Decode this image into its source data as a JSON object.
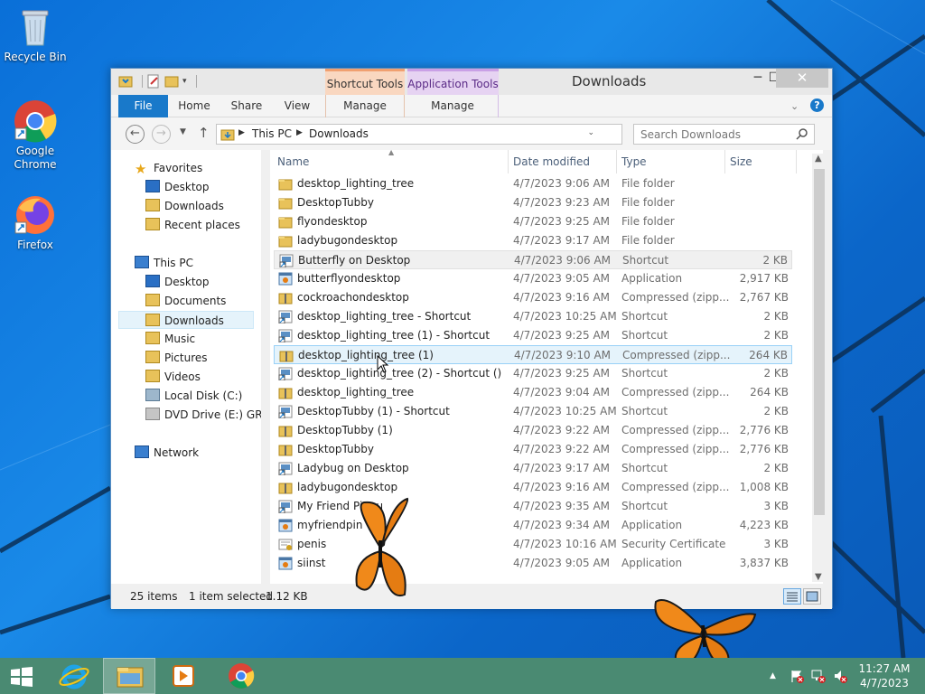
{
  "desktop": {
    "icons": [
      {
        "label": "Recycle Bin",
        "icon": "recycle-bin-icon"
      },
      {
        "label": "Google Chrome",
        "icon": "chrome-icon"
      },
      {
        "label": "Firefox",
        "icon": "firefox-icon"
      }
    ]
  },
  "window": {
    "title": "Downloads",
    "context_tabs": {
      "shortcut_tools": "Shortcut Tools",
      "application_tools": "Application Tools"
    },
    "ribbon_tabs": {
      "file": "File",
      "home": "Home",
      "share": "Share",
      "view": "View",
      "manage1": "Manage",
      "manage2": "Manage"
    },
    "address": {
      "crumbs": [
        "This PC",
        "Downloads"
      ]
    },
    "search": {
      "placeholder": "Search Downloads"
    },
    "nav": {
      "favorites": "Favorites",
      "fav_items": [
        "Desktop",
        "Downloads",
        "Recent places"
      ],
      "this_pc": "This PC",
      "pc_items": [
        "Desktop",
        "Documents",
        "Downloads",
        "Music",
        "Pictures",
        "Videos",
        "Local Disk (C:)",
        "DVD Drive (E:) GRTM"
      ],
      "network": "Network",
      "selected": "Downloads"
    },
    "columns": {
      "name": "Name",
      "date": "Date modified",
      "type": "Type",
      "size": "Size"
    },
    "files": [
      {
        "name": "desktop_lighting_tree",
        "date": "4/7/2023 9:06 AM",
        "type": "File folder",
        "size": "",
        "icon": "folder-icon"
      },
      {
        "name": "DesktopTubby",
        "date": "4/7/2023 9:23 AM",
        "type": "File folder",
        "size": "",
        "icon": "folder-icon"
      },
      {
        "name": "flyondesktop",
        "date": "4/7/2023 9:25 AM",
        "type": "File folder",
        "size": "",
        "icon": "folder-icon"
      },
      {
        "name": "ladybugondesktop",
        "date": "4/7/2023 9:17 AM",
        "type": "File folder",
        "size": "",
        "icon": "folder-icon"
      },
      {
        "name": "Butterfly on Desktop",
        "date": "4/7/2023 9:06 AM",
        "type": "Shortcut",
        "size": "2 KB",
        "icon": "shortcut-icon"
      },
      {
        "name": "butterflyondesktop",
        "date": "4/7/2023 9:05 AM",
        "type": "Application",
        "size": "2,917 KB",
        "icon": "application-icon"
      },
      {
        "name": "cockroachondesktop",
        "date": "4/7/2023 9:16 AM",
        "type": "Compressed (zipp...",
        "size": "2,767 KB",
        "icon": "zip-icon"
      },
      {
        "name": "desktop_lighting_tree - Shortcut",
        "date": "4/7/2023 10:25 AM",
        "type": "Shortcut",
        "size": "2 KB",
        "icon": "shortcut-icon"
      },
      {
        "name": "desktop_lighting_tree (1) - Shortcut",
        "date": "4/7/2023 9:25 AM",
        "type": "Shortcut",
        "size": "2 KB",
        "icon": "shortcut-icon"
      },
      {
        "name": "desktop_lighting_tree (1)",
        "date": "4/7/2023 9:10 AM",
        "type": "Compressed (zipp...",
        "size": "264 KB",
        "icon": "zip-icon"
      },
      {
        "name": "desktop_lighting_tree (2) - Shortcut ()",
        "date": "4/7/2023 9:25 AM",
        "type": "Shortcut",
        "size": "2 KB",
        "icon": "shortcut-icon"
      },
      {
        "name": "desktop_lighting_tree",
        "date": "4/7/2023 9:04 AM",
        "type": "Compressed (zipp...",
        "size": "264 KB",
        "icon": "zip-icon"
      },
      {
        "name": "DesktopTubby (1) - Shortcut",
        "date": "4/7/2023 10:25 AM",
        "type": "Shortcut",
        "size": "2 KB",
        "icon": "shortcut-icon"
      },
      {
        "name": "DesktopTubby (1)",
        "date": "4/7/2023 9:22 AM",
        "type": "Compressed (zipp...",
        "size": "2,776 KB",
        "icon": "zip-icon"
      },
      {
        "name": "DesktopTubby",
        "date": "4/7/2023 9:22 AM",
        "type": "Compressed (zipp...",
        "size": "2,776 KB",
        "icon": "zip-icon"
      },
      {
        "name": "Ladybug on Desktop",
        "date": "4/7/2023 9:17 AM",
        "type": "Shortcut",
        "size": "2 KB",
        "icon": "shortcut-icon"
      },
      {
        "name": "ladybugondesktop",
        "date": "4/7/2023 9:16 AM",
        "type": "Compressed (zipp...",
        "size": "1,008 KB",
        "icon": "zip-icon"
      },
      {
        "name": "My Friend Pingu",
        "date": "4/7/2023 9:35 AM",
        "type": "Shortcut",
        "size": "3 KB",
        "icon": "shortcut-icon"
      },
      {
        "name": "myfriendpin",
        "date": "4/7/2023 9:34 AM",
        "type": "Application",
        "size": "4,223 KB",
        "icon": "application-icon"
      },
      {
        "name": "penis",
        "date": "4/7/2023 10:16 AM",
        "type": "Security Certificate",
        "size": "3 KB",
        "icon": "certificate-icon"
      },
      {
        "name": "siinst",
        "date": "4/7/2023 9:05 AM",
        "type": "Application",
        "size": "3,837 KB",
        "icon": "application-icon"
      }
    ],
    "hover_row": 4,
    "selected_row": 9,
    "status": {
      "count": "25 items",
      "selection": "1 item selected",
      "size": "1.12 KB"
    }
  },
  "taskbar": {
    "clock_time": "11:27 AM",
    "clock_date": "4/7/2023"
  },
  "colors": {
    "accent": "#1979ca",
    "taskbar": "#4a8a72"
  }
}
